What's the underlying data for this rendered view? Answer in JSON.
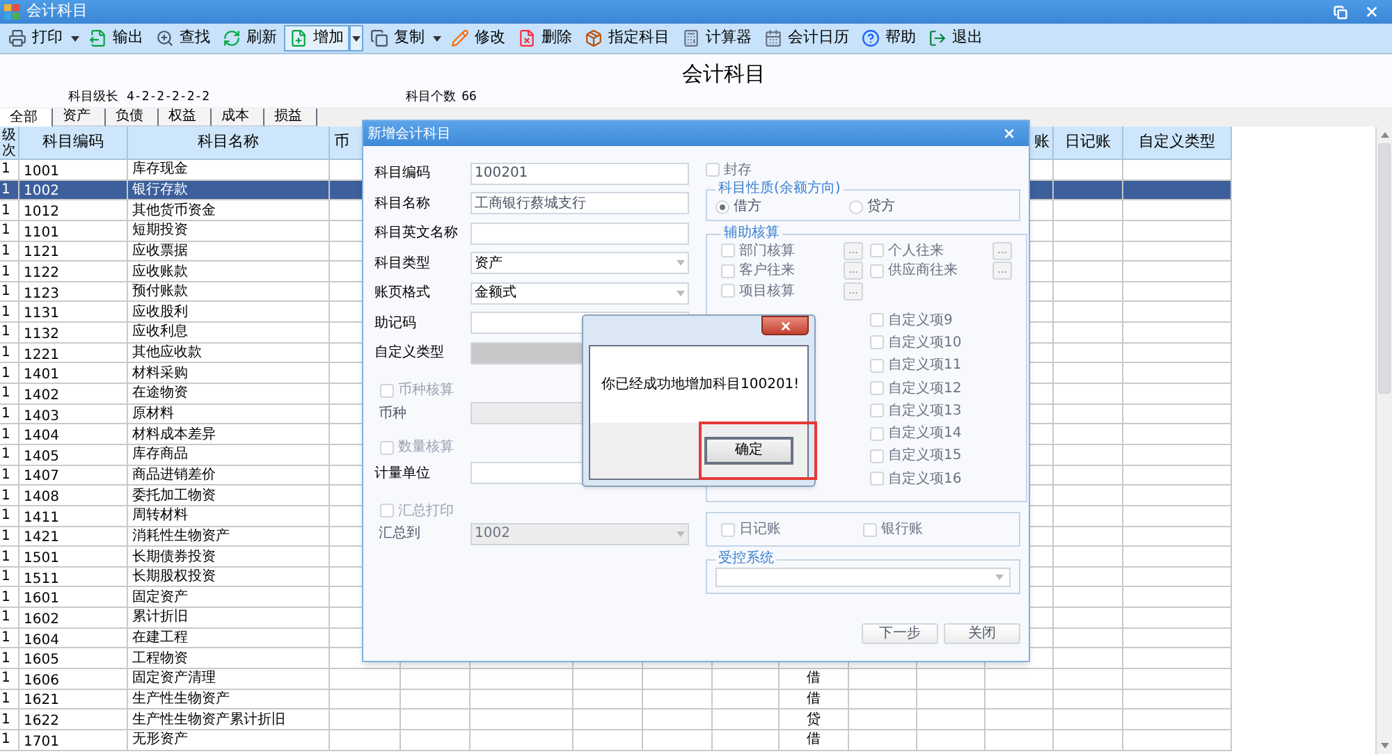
{
  "window": {
    "title": "会计科目"
  },
  "toolbar": [
    {
      "label": "打印",
      "kind": "split",
      "selected": false
    },
    {
      "label": "输出",
      "kind": "button",
      "selected": false
    },
    {
      "label": "查找",
      "kind": "button",
      "selected": false
    },
    {
      "label": "刷新",
      "kind": "button",
      "selected": false
    },
    {
      "label": "增加",
      "kind": "split",
      "selected": true
    },
    {
      "label": "复制",
      "kind": "split",
      "selected": false
    },
    {
      "label": "修改",
      "kind": "button",
      "selected": false
    },
    {
      "label": "删除",
      "kind": "button",
      "selected": false
    },
    {
      "label": "指定科目",
      "kind": "button",
      "selected": false
    },
    {
      "label": "计算器",
      "kind": "button",
      "selected": false
    },
    {
      "label": "会计日历",
      "kind": "button",
      "selected": false
    },
    {
      "label": "帮助",
      "kind": "button",
      "selected": false
    },
    {
      "label": "退出",
      "kind": "button",
      "selected": false
    }
  ],
  "page": {
    "title": "会计科目",
    "level_label": "科目级长",
    "level_value": "4-2-2-2-2-2",
    "count_label": "科目个数",
    "count_value": "66"
  },
  "tabs": [
    {
      "label": "全部",
      "selected": true
    },
    {
      "label": "资产",
      "selected": false
    },
    {
      "label": "负债",
      "selected": false
    },
    {
      "label": "权益",
      "selected": false
    },
    {
      "label": "成本",
      "selected": false
    },
    {
      "label": "损益",
      "selected": false
    }
  ],
  "table": {
    "columns": [
      "级次",
      "科目编码",
      "科目名称",
      "币",
      "账",
      "日记账",
      "自定义类型"
    ],
    "rows": [
      {
        "level": "1",
        "code": "1001",
        "name": "库存现金",
        "selected": false
      },
      {
        "level": "1",
        "code": "1002",
        "name": "银行存款",
        "selected": true
      },
      {
        "level": "1",
        "code": "1012",
        "name": "其他货币资金",
        "selected": false
      },
      {
        "level": "1",
        "code": "1101",
        "name": "短期投资",
        "selected": false
      },
      {
        "level": "1",
        "code": "1121",
        "name": "应收票据",
        "selected": false
      },
      {
        "level": "1",
        "code": "1122",
        "name": "应收账款",
        "selected": false
      },
      {
        "level": "1",
        "code": "1123",
        "name": "预付账款",
        "selected": false
      },
      {
        "level": "1",
        "code": "1131",
        "name": "应收股利",
        "selected": false
      },
      {
        "level": "1",
        "code": "1132",
        "name": "应收利息",
        "selected": false
      },
      {
        "level": "1",
        "code": "1221",
        "name": "其他应收款",
        "selected": false
      },
      {
        "level": "1",
        "code": "1401",
        "name": "材料采购",
        "selected": false
      },
      {
        "level": "1",
        "code": "1402",
        "name": "在途物资",
        "selected": false
      },
      {
        "level": "1",
        "code": "1403",
        "name": "原材料",
        "selected": false
      },
      {
        "level": "1",
        "code": "1404",
        "name": "材料成本差异",
        "selected": false
      },
      {
        "level": "1",
        "code": "1405",
        "name": "库存商品",
        "selected": false
      },
      {
        "level": "1",
        "code": "1407",
        "name": "商品进销差价",
        "selected": false
      },
      {
        "level": "1",
        "code": "1408",
        "name": "委托加工物资",
        "selected": false
      },
      {
        "level": "1",
        "code": "1411",
        "name": "周转材料",
        "selected": false
      },
      {
        "level": "1",
        "code": "1421",
        "name": "消耗性生物资产",
        "selected": false
      },
      {
        "level": "1",
        "code": "1501",
        "name": "长期债券投资",
        "selected": false
      },
      {
        "level": "1",
        "code": "1511",
        "name": "长期股权投资",
        "selected": false
      },
      {
        "level": "1",
        "code": "1601",
        "name": "固定资产",
        "selected": false
      },
      {
        "level": "1",
        "code": "1602",
        "name": "累计折旧",
        "selected": false
      },
      {
        "level": "1",
        "code": "1604",
        "name": "在建工程",
        "selected": false
      },
      {
        "level": "1",
        "code": "1605",
        "name": "工程物资",
        "selected": false
      },
      {
        "level": "1",
        "code": "1606",
        "name": "固定资产清理",
        "selected": false,
        "direction": "借"
      },
      {
        "level": "1",
        "code": "1621",
        "name": "生产性生物资产",
        "selected": false,
        "direction": "借"
      },
      {
        "level": "1",
        "code": "1622",
        "name": "生产性生物资产累计折旧",
        "selected": false,
        "direction": "贷"
      },
      {
        "level": "1",
        "code": "1701",
        "name": "无形资产",
        "selected": false,
        "direction": "借"
      }
    ]
  },
  "dialog": {
    "title": "新增会计科目",
    "left": [
      {
        "kind": "text",
        "label": "科目编码",
        "value": "100201"
      },
      {
        "kind": "text",
        "label": "科目名称",
        "value": "工商银行蔡城支行"
      },
      {
        "kind": "text",
        "label": "科目英文名称"
      },
      {
        "kind": "select",
        "label": "科目类型",
        "value": "资产"
      },
      {
        "kind": "select",
        "label": "账页格式",
        "value": "金额式"
      },
      {
        "kind": "text",
        "label": "助记码"
      },
      {
        "kind": "grey",
        "label": "自定义类型"
      },
      {
        "kind": "check",
        "label": "币种核算",
        "checked": false
      },
      {
        "kind": "disabled",
        "label": "币种"
      },
      {
        "kind": "check",
        "label": "数量核算",
        "checked": false
      },
      {
        "kind": "text",
        "label": "计量单位"
      },
      {
        "kind": "check",
        "label": "汇总打印",
        "checked": false
      },
      {
        "kind": "disabled-select",
        "label": "汇总到",
        "value": "1002"
      }
    ],
    "seal": {
      "label": "封存",
      "checked": false
    },
    "direction": {
      "title": "科目性质(余额方向)",
      "options": [
        {
          "label": "借方",
          "selected": true
        },
        {
          "label": "贷方",
          "selected": false
        }
      ]
    },
    "aux": {
      "title": "辅助核算",
      "left": [
        {
          "label": "部门核算",
          "checked": false,
          "more": "..."
        },
        {
          "label": "客户往来",
          "checked": false,
          "more": "..."
        },
        {
          "label": "项目核算",
          "checked": false,
          "more": "..."
        }
      ],
      "right": [
        {
          "label": "个人往来",
          "checked": false,
          "more": "..."
        },
        {
          "label": "供应商往来",
          "checked": false,
          "more": "..."
        },
        {
          "label": "自定义项9",
          "checked": false
        },
        {
          "label": "自定义项10",
          "checked": false
        },
        {
          "label": "自定义项11",
          "checked": false
        },
        {
          "label": "自定义项12",
          "checked": false
        },
        {
          "label": "自定义项13",
          "checked": false
        },
        {
          "label": "自定义项14",
          "checked": false
        },
        {
          "label": "自定义项15",
          "checked": false
        },
        {
          "label": "自定义项16",
          "checked": false
        }
      ]
    },
    "books": [
      {
        "label": "日记账",
        "checked": false
      },
      {
        "label": "银行账",
        "checked": false
      }
    ],
    "control": {
      "title": "受控系统"
    },
    "buttons": [
      "下一步",
      "关闭"
    ]
  },
  "message": {
    "text": "你已经成功地增加科目100201!",
    "ok": "确定"
  }
}
